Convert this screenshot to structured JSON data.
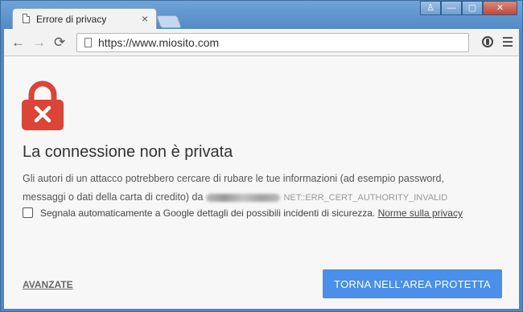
{
  "window": {
    "buttons": {
      "user": "♙",
      "minimize": "—",
      "maximize": "▢",
      "close": "✕"
    }
  },
  "tab": {
    "title": "Errore di privacy",
    "close_glyph": "×"
  },
  "toolbar": {
    "back_glyph": "←",
    "forward_glyph": "→",
    "reload_glyph": "⟳",
    "url": "https://www.miosito.com"
  },
  "page": {
    "headline": "La connessione non è privata",
    "body": "Gli autori di un attacco potrebbero cercare di rubare le tue informazioni (ad esempio password, messaggi o dati della carta di credito) da",
    "error_code": "NET::ERR_CERT_AUTHORITY_INVALID",
    "checkbox_label": "Segnala automaticamente a Google dettagli dei possibili incidenti di sicurezza.",
    "privacy_link": "Norme sulla privacy",
    "advanced_link": "AVANZATE",
    "primary_button": "TORNA NELL'AREA PROTETTA"
  },
  "colors": {
    "lock_red": "#db4437",
    "primary_blue": "#4a8fe9",
    "frame_blue": "#5a8fc4"
  }
}
